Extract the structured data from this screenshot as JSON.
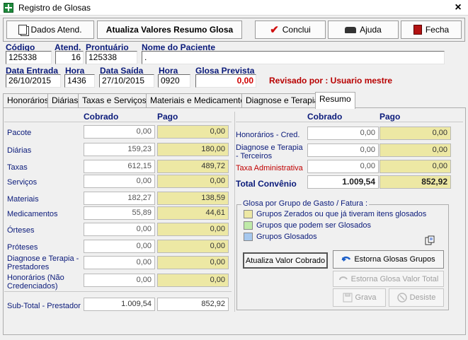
{
  "window": {
    "title": "Registro de Glosas",
    "close_label": "×"
  },
  "toolbar": {
    "dados": "Dados Atend.",
    "atualiza": "Atualiza Valores Resumo Glosa",
    "conclui": "Conclui",
    "ajuda": "Ajuda",
    "fecha": "Fecha"
  },
  "patient": {
    "codigo_label": "Código",
    "codigo": "125338",
    "atend_label": "Atend.",
    "atend": "16",
    "prontuario_label": "Prontuário",
    "prontuario": "125338",
    "nome_label": "Nome do Paciente",
    "nome": ".",
    "entrada_label": "Data Entrada",
    "entrada": "26/10/2015",
    "hora1_label": "Hora",
    "hora1": "1436",
    "saida_label": "Data Saída",
    "saida": "27/10/2015",
    "hora2_label": "Hora",
    "hora2": "0920",
    "glosa_label": "Glosa Prevista",
    "glosa": "0,00",
    "revisado": "Revisado por : Usuario mestre"
  },
  "tabs": [
    "Honorários",
    "Diárias",
    "Taxas e Serviços",
    "Materiais e Medicamentos",
    "Diagnose e Terapia",
    "Resumo"
  ],
  "left": {
    "cobrado_hdr": "Cobrado",
    "pago_hdr": "Pago",
    "rows": [
      {
        "label": "Pacote",
        "cobrado": "0,00",
        "pago": "0,00"
      },
      {
        "label": "Diárias",
        "cobrado": "159,23",
        "pago": "180,00"
      },
      {
        "label": "Taxas",
        "cobrado": "612,15",
        "pago": "489,72"
      },
      {
        "label": "Serviços",
        "cobrado": "0,00",
        "pago": "0,00"
      },
      {
        "label": "Materiais",
        "cobrado": "182,27",
        "pago": "138,59"
      },
      {
        "label": "Medicamentos",
        "cobrado": "55,89",
        "pago": "44,61"
      },
      {
        "label": "Órteses",
        "cobrado": "0,00",
        "pago": "0,00"
      },
      {
        "label": "Próteses",
        "cobrado": "0,00",
        "pago": "0,00"
      },
      {
        "label": "Diagnose e Terapia - Prestadores",
        "cobrado": "0,00",
        "pago": "0,00"
      },
      {
        "label": "Honorários (Não Credenciados)",
        "cobrado": "0,00",
        "pago": "0,00"
      }
    ],
    "subtotal": {
      "label": "Sub-Total - Prestador",
      "cobrado": "1.009,54",
      "pago": "852,92"
    }
  },
  "right": {
    "cobrado_hdr": "Cobrado",
    "pago_hdr": "Pago",
    "rows": [
      {
        "label": "Honorários - Cred.",
        "cobrado": "0,00",
        "pago": "0,00"
      },
      {
        "label": "Diagnose e Terapia - Terceiros",
        "cobrado": "0,00",
        "pago": "0,00"
      },
      {
        "label": "Taxa Administrativa",
        "cobrado": "0,00",
        "pago": "0,00"
      }
    ],
    "total": {
      "label": "Total Convênio",
      "cobrado": "1.009,54",
      "pago": "852,92"
    }
  },
  "glosa_group": {
    "title": "Glosa por Grupo de Gasto / Fatura :",
    "legend": [
      {
        "label": "Grupos Zerados ou que já  tiveram itens glosados",
        "color": "#ede8a4"
      },
      {
        "label": "Grupos que podem ser Glosados",
        "color": "#bfeaa8"
      },
      {
        "label": "Grupos  Glosados",
        "color": "#a6c8ee"
      }
    ],
    "btn_atualiza": "Atualiza Valor Cobrado",
    "btn_estorna_grupos": "Estorna Glosas Grupos",
    "btn_estorna_total": "Estorna Glosa Valor Total",
    "btn_grava": "Grava",
    "btn_desiste": "Desiste"
  }
}
